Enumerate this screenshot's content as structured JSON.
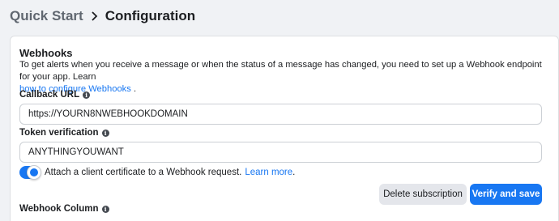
{
  "breadcrumb": {
    "parent": "Quick Start",
    "current": "Configuration"
  },
  "webhooks": {
    "title": "Webhooks",
    "description": "To get alerts when you receive a message or when the status of a message has changed, you need to set up a Webhook endpoint for your app. Learn",
    "description_link": "how to configure Webhooks",
    "description_end": " ."
  },
  "callback": {
    "label": "Callback URL",
    "value": "https://YOURN8NWEBHOOKDOMAIN"
  },
  "token": {
    "label": "Token verification",
    "value": "ANYTHINGYOUWANT"
  },
  "certificate": {
    "text": "Attach a client certificate to a Webhook request.",
    "link": "Learn more",
    "end": " .",
    "enabled": true
  },
  "buttons": {
    "delete": "Delete subscription",
    "verify": "Verify and save"
  },
  "webhook_column": {
    "label": "Webhook Column"
  },
  "colors": {
    "accent": "#1877f2",
    "background": "#f0f2f5"
  }
}
